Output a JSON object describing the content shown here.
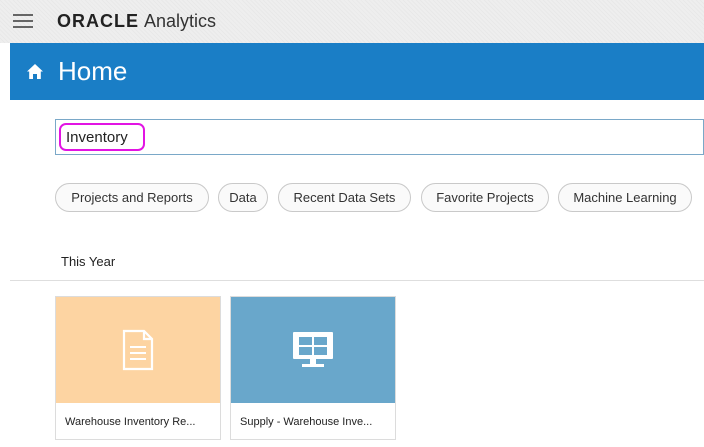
{
  "app": {
    "brand_logo": "ORACLE",
    "brand_product": "Analytics",
    "menu_icon": "hamburger-menu-icon"
  },
  "header": {
    "title": "Home",
    "icon": "home-icon",
    "color": "#1a7ec6"
  },
  "search": {
    "value": "Inventory",
    "highlight_color": "#e214e3"
  },
  "filters": [
    {
      "label": "Projects and Reports"
    },
    {
      "label": "Data"
    },
    {
      "label": "Recent Data Sets"
    },
    {
      "label": "Favorite Projects"
    },
    {
      "label": "Machine Learning"
    }
  ],
  "section": {
    "label": "This Year"
  },
  "cards": [
    {
      "label": "Warehouse Inventory Re...",
      "icon": "report-document-icon",
      "color": "#fdd4a2"
    },
    {
      "label": "Supply - Warehouse Inve...",
      "icon": "project-monitor-icon",
      "color": "#69a7cb"
    }
  ]
}
